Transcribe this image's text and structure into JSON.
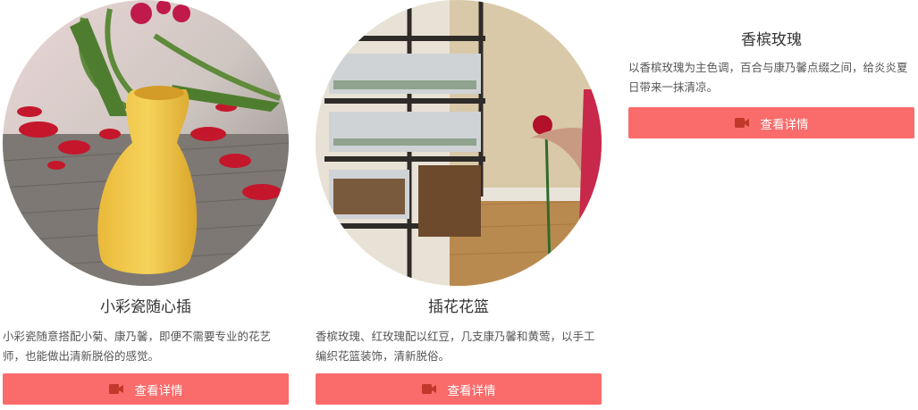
{
  "products": [
    {
      "title": "小彩瓷随心插",
      "desc": "小彩瓷随意搭配小菊、康乃馨，即便不需要专业的花艺师，也能做出清新脱俗的感觉。",
      "button_label": "查看详情",
      "icon": "video-camera-icon"
    },
    {
      "title": "插花花篮",
      "desc": "香槟玫瑰、红玫瑰配以红豆，几支康乃馨和黄莺，以手工编织花篮装饰，清新脱俗。",
      "button_label": "查看详情",
      "icon": "video-camera-icon"
    },
    {
      "title": "香槟玫瑰",
      "desc": "以香槟玫瑰为主色调，百合与康乃馨点缀之间，给炎炎夏日带来一抹清凉。",
      "button_label": "查看详情",
      "icon": "video-camera-icon"
    }
  ],
  "colors": {
    "button_bg": "#fa6b6b",
    "icon_color": "#c0392b",
    "title_color": "#333333",
    "desc_color": "#555555"
  }
}
